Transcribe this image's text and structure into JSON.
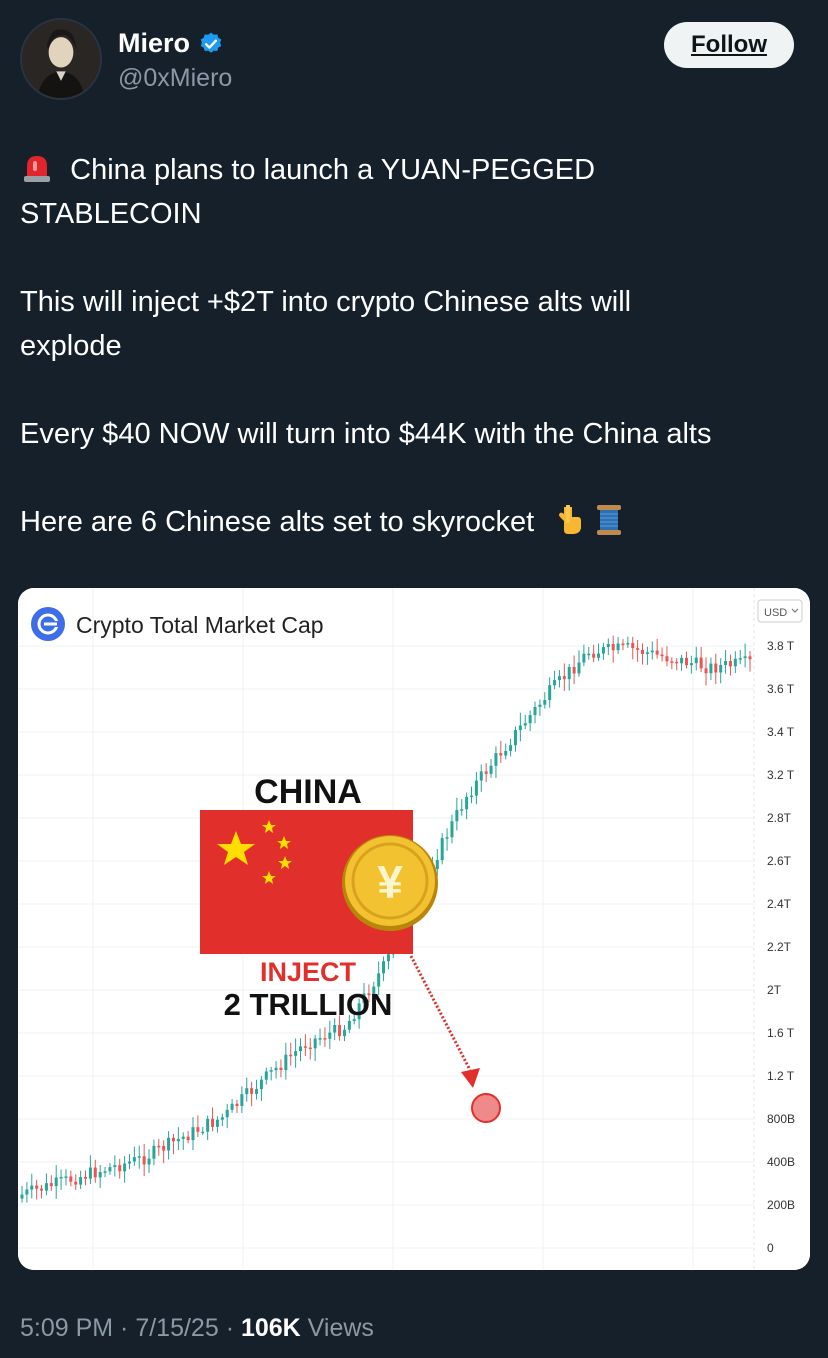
{
  "author": {
    "display_name": "Miero",
    "handle": "@0xMiero",
    "verified": true,
    "verified_color": "#1d9bf0"
  },
  "actions": {
    "follow_label": "Follow"
  },
  "tweet": {
    "line1_emoji": "rotating-light-icon",
    "line1": "China plans to launch a YUAN-PEGGED",
    "line2": "STABLECOIN",
    "line3": "This will inject +$2T into crypto Chinese alts will",
    "line4": "explode",
    "line5": "Every $40 NOW will turn into $44K with the China alts",
    "line6": "Here are 6 Chinese alts set to skyrocket",
    "line6_emojis": [
      "pointing-down-icon",
      "thread-icon"
    ]
  },
  "media": {
    "chart_title": "Crypto Total Market Cap",
    "currency_selector": "USD",
    "graphic_heading": "CHINA",
    "coin_symbol": "¥",
    "inject_label": "INJECT",
    "amount_label": "2 TRILLION",
    "colors": {
      "up": "#26a69a",
      "down": "#ef5350",
      "flag_red": "#e1302b",
      "star": "#ffde00"
    }
  },
  "chart_data": {
    "type": "line",
    "title": "Crypto Total Market Cap",
    "y_ticks": [
      "3.8 T",
      "3.6 T",
      "3.4 T",
      "3.2 T",
      "2.8T",
      "2.6T",
      "2.4T",
      "2.2T",
      "2T",
      "1.6 T",
      "1.2 T",
      "800B",
      "400B",
      "200B",
      "0"
    ],
    "approx_trend_T": [
      0.15,
      0.2,
      0.25,
      0.3,
      0.4,
      0.5,
      0.7,
      0.9,
      1.0,
      1.4,
      2.0,
      2.6,
      3.0,
      3.4,
      3.75,
      3.78,
      3.7,
      3.62,
      3.66
    ],
    "marker": "INJECT 2 TRILLION",
    "ylabel": ""
  },
  "footer": {
    "time": "5:09 PM",
    "sep1": " · ",
    "date": "7/15/25",
    "sep2": " · ",
    "views_count": "106K",
    "views_label": " Views"
  }
}
